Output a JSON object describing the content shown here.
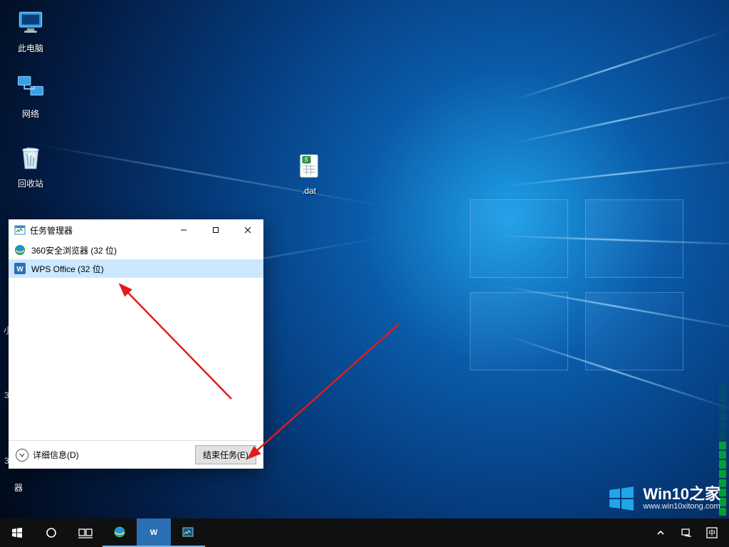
{
  "desktop_icons": {
    "this_pc": "此电脑",
    "network": "网络",
    "recycle_bin": "回收站",
    "dat_file": ".dat"
  },
  "taskmgr": {
    "title": "任务管理器",
    "processes": [
      {
        "name": "360安全浏览器 (32 位)",
        "icon": "ie"
      },
      {
        "name": "WPS Office (32 位)",
        "icon": "wps",
        "selected": true
      }
    ],
    "more_details": "详细信息(D)",
    "end_task": "结束任务(E)"
  },
  "stray_labels": {
    "left_small": "小",
    "left_3a": "3",
    "left_3b": "3",
    "bottom": "器"
  },
  "watermark": {
    "title": "Win10之家",
    "url": "www.win10xitong.com"
  },
  "colors": {
    "selection": "#cce8ff",
    "taskbar": "#101010",
    "accent": "#0078d7",
    "arrow": "#e21b1b"
  }
}
